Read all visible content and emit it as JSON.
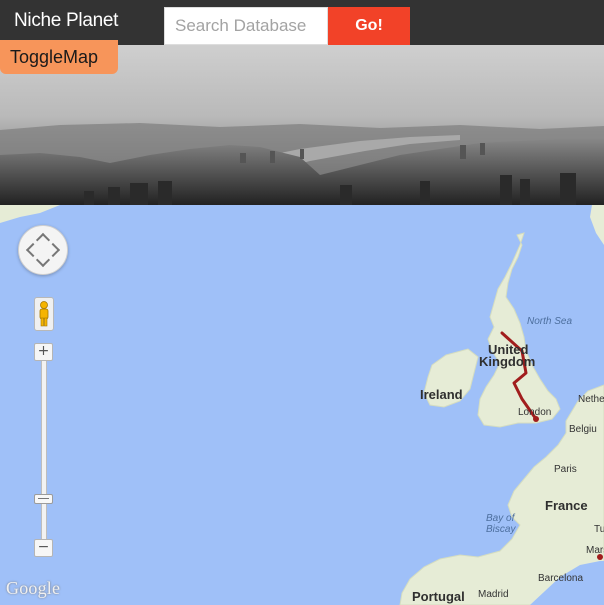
{
  "header": {
    "brand": "Niche Planet",
    "search_placeholder": "Search Database",
    "search_value": "",
    "go_label": "Go!",
    "toggle_label": "ToggleMap"
  },
  "map": {
    "countries": [
      "United Kingdom",
      "Ireland",
      "France",
      "Portugal",
      "Belgium",
      "Netherlands"
    ],
    "labels": {
      "united": "United",
      "kingdom": "Kingdom",
      "ireland": "Ireland",
      "france": "France",
      "portugal": "Portugal",
      "belgium": "Belgiu",
      "netherlands": "Nethe",
      "london": "London",
      "paris": "Paris",
      "barcelona": "Barcelona",
      "madrid": "Madrid",
      "marseille": "Marse",
      "tu": "Tu",
      "north_sea": "North Sea",
      "bay_of": "Bay of",
      "biscay": "Biscay"
    },
    "attribution": "Google",
    "route_color": "#a11d1d",
    "water_color": "#9fc0f8",
    "land_color": "#e6ecd6"
  },
  "controls": {
    "zoom_in": "+",
    "zoom_out": "−"
  },
  "colors": {
    "navbar": "#333333",
    "go_button": "#f24228",
    "toggle_button": "#f7955a"
  }
}
